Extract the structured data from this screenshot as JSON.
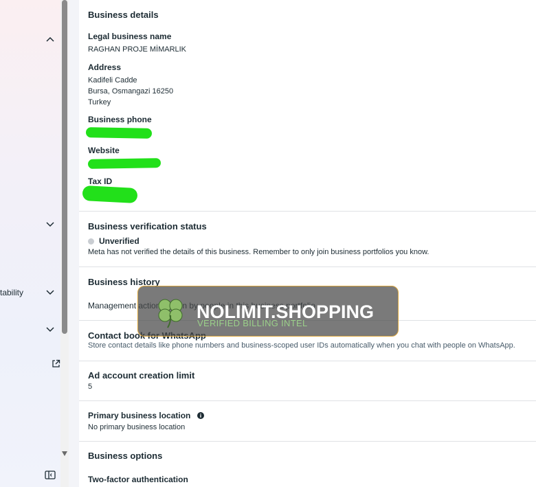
{
  "sidebar": {
    "partial_item_label": "tability"
  },
  "business_details": {
    "title": "Business details",
    "legal_name_label": "Legal business name",
    "legal_name_value": "RAGHAN PROJE MİMARLIK",
    "address_label": "Address",
    "address_line1": "Kadifeli Cadde",
    "address_line2": "Bursa, Osmangazi 16250",
    "address_line3": "Turkey",
    "phone_label": "Business phone",
    "website_label": "Website",
    "tax_label": "Tax ID"
  },
  "verification": {
    "title": "Business verification status",
    "status": "Unverified",
    "note": "Meta has not verified the details of this business. Remember to only join business portfolios you know."
  },
  "history": {
    "title": "Business history",
    "note": "Management actions taken by people in this business portfolio"
  },
  "contact_book": {
    "title": "Contact book for WhatsApp",
    "note": "Store contact details like phone numbers and business-scoped user IDs automatically when you chat with people on WhatsApp."
  },
  "ad_limit": {
    "title": "Ad account creation limit",
    "value": "5"
  },
  "location": {
    "title": "Primary business location",
    "value": "No primary business location"
  },
  "options": {
    "title": "Business options",
    "two_factor": "Two-factor authentication"
  },
  "watermark": {
    "title": "NOLIMIT.SHOPPING",
    "subtitle": "VERIFIED BILLING INTEL"
  },
  "colors": {
    "redaction": "#22e01a",
    "watermark_border": "#d8a33a",
    "watermark_subtitle": "#9bd08a"
  }
}
